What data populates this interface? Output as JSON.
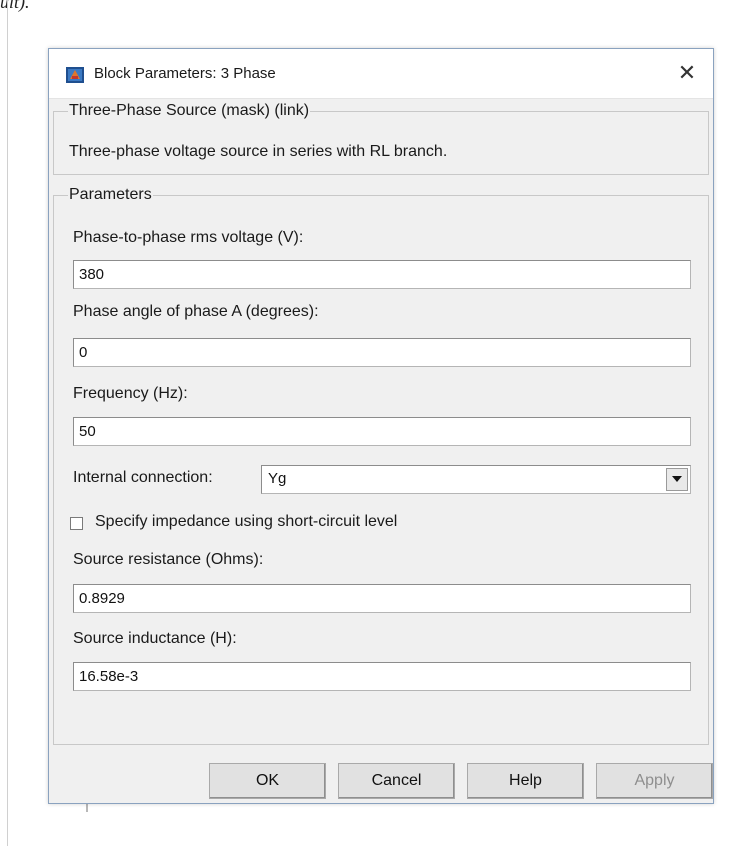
{
  "page": {
    "top_fragment_text": "ult)."
  },
  "dialog": {
    "title": "Block Parameters: 3 Phase",
    "icon": "simulink-block-icon",
    "close_glyph": "✕"
  },
  "description_group": {
    "label": "Three-Phase Source (mask) (link)",
    "text": "Three-phase voltage source in series with RL branch."
  },
  "parameters": {
    "label": "Parameters",
    "voltage": {
      "label": "Phase-to-phase rms voltage (V):",
      "value": "380"
    },
    "phase_angle": {
      "label": "Phase angle of phase A (degrees):",
      "value": "0"
    },
    "frequency": {
      "label": "Frequency (Hz):",
      "value": "50"
    },
    "internal_connection": {
      "label": "Internal connection:",
      "value": "Yg"
    },
    "short_circuit": {
      "label": "Specify impedance using short-circuit level",
      "checked": false
    },
    "resistance": {
      "label": "Source resistance (Ohms):",
      "value": "0.8929"
    },
    "inductance": {
      "label": "Source inductance (H):",
      "value": "16.58e-3"
    }
  },
  "buttons": {
    "ok": "OK",
    "cancel": "Cancel",
    "help": "Help",
    "apply": "Apply"
  },
  "colors": {
    "dialog_bg": "#f0f0f0",
    "titlebar_bg": "#ffffff",
    "border_accent": "#8aa2bf",
    "disabled_text": "#8e8e8e"
  }
}
